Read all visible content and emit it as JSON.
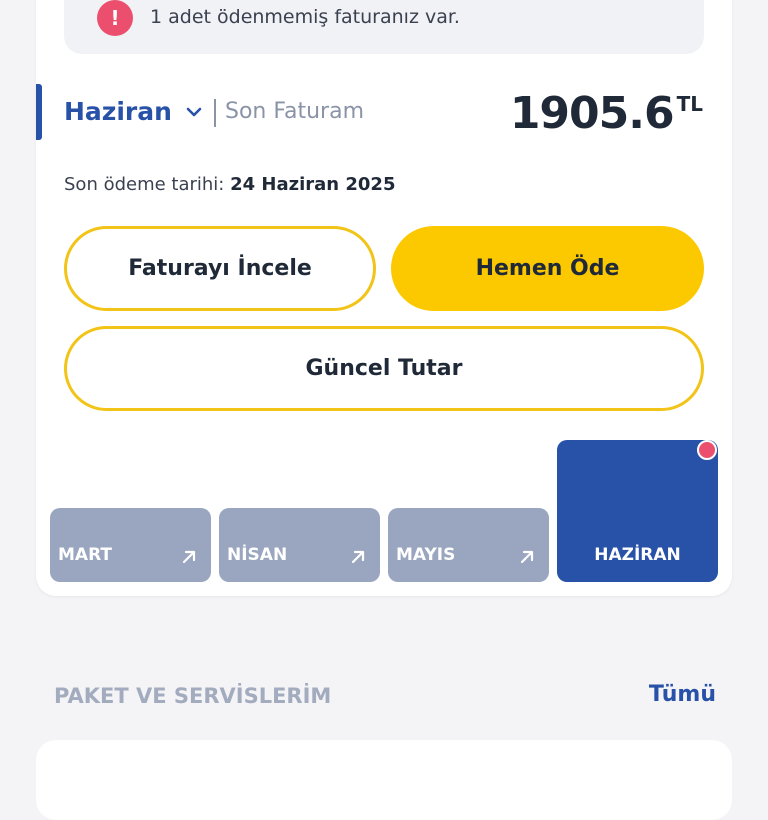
{
  "alert": {
    "icon": "exclamation-icon",
    "icon_glyph": "!",
    "text": "1 adet ödenmemiş faturanız var."
  },
  "bill": {
    "month": "Haziran",
    "last_bill_label": "Son Faturam",
    "amount": "1905.6",
    "currency": "TL",
    "due_label": "Son ödeme tarihi:",
    "due_date": "24 Haziran 2025"
  },
  "actions": {
    "review_label": "Faturayı İncele",
    "pay_label": "Hemen Öde",
    "current_amount_label": "Güncel Tutar"
  },
  "months": [
    {
      "label": "MART"
    },
    {
      "label": "NİSAN"
    },
    {
      "label": "MAYIS"
    },
    {
      "label": "HAZİRAN",
      "active": true
    }
  ],
  "section": {
    "title": "PAKET VE SERVİSLERİM",
    "see_all_label": "Tümü"
  },
  "colors": {
    "brand_blue": "#2752a8",
    "brand_yellow": "#fcc800",
    "alert_red": "#ec4f6d",
    "inactive_tab": "#9aa6bf"
  }
}
